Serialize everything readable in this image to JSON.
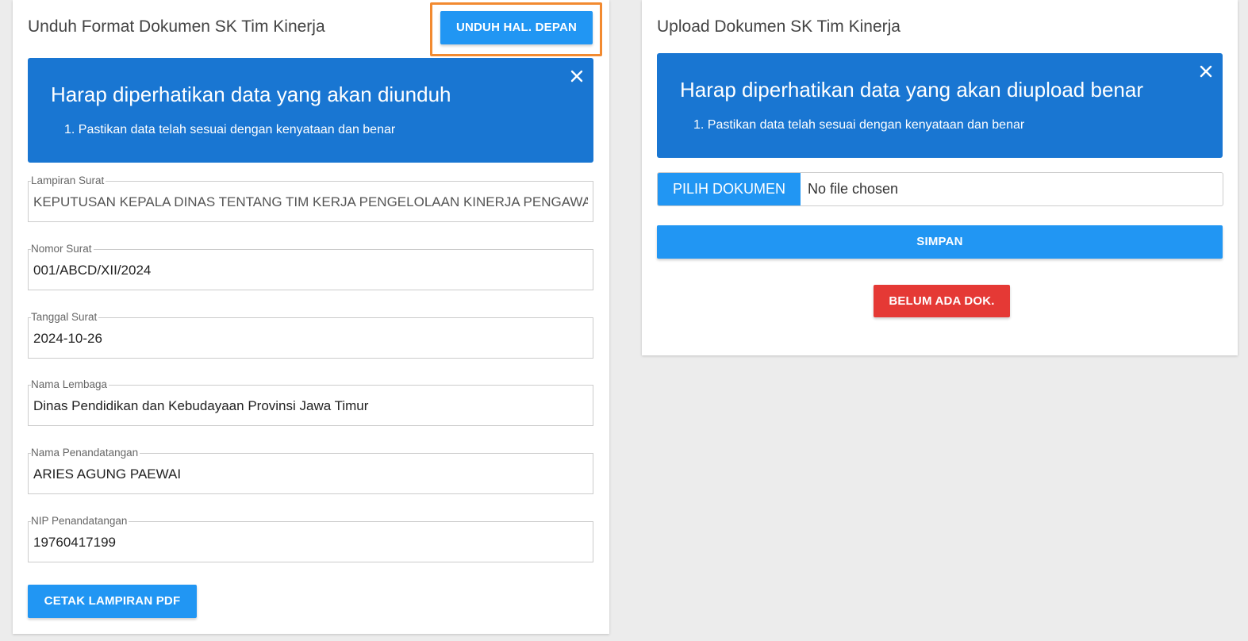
{
  "left_card": {
    "title": "Unduh Format Dokumen SK Tim Kinerja",
    "unduh_button": "UNDUH HAL. DEPAN",
    "alert": {
      "title": "Harap diperhatikan data yang akan diunduh",
      "item_1": "1. Pastikan data telah sesuai dengan kenyataan dan benar"
    },
    "fields": {
      "lampiran": {
        "label": "Lampiran Surat",
        "value": "KEPUTUSAN KEPALA DINAS TENTANG TIM KERJA PENGELOLAAN KINERJA PENGAWAS"
      },
      "nomor": {
        "label": "Nomor Surat",
        "value": "001/ABCD/XII/2024"
      },
      "tanggal": {
        "label": "Tanggal Surat",
        "value": "2024-10-26"
      },
      "lembaga": {
        "label": "Nama Lembaga",
        "value": "Dinas Pendidikan dan Kebudayaan Provinsi Jawa Timur"
      },
      "penandatangan": {
        "label": "Nama Penandatangan",
        "value": "ARIES AGUNG PAEWAI"
      },
      "nip": {
        "label": "NIP Penandatangan",
        "value": "19760417199"
      }
    },
    "cetak_button": "CETAK LAMPIRAN PDF"
  },
  "right_card": {
    "title": "Upload Dokumen SK Tim Kinerja",
    "alert": {
      "title": "Harap diperhatikan data yang akan diupload benar",
      "item_1": "1. Pastikan data telah sesuai dengan kenyataan dan benar"
    },
    "file_button": "PILIH DOKUMEN",
    "file_status": "No file chosen",
    "simpan_button": "SIMPAN",
    "belum_button": "BELUM ADA DOK."
  },
  "colors": {
    "primary": "#2196f3",
    "alert_bg": "#1976d2",
    "danger": "#e53935",
    "highlight": "#f28a30"
  }
}
